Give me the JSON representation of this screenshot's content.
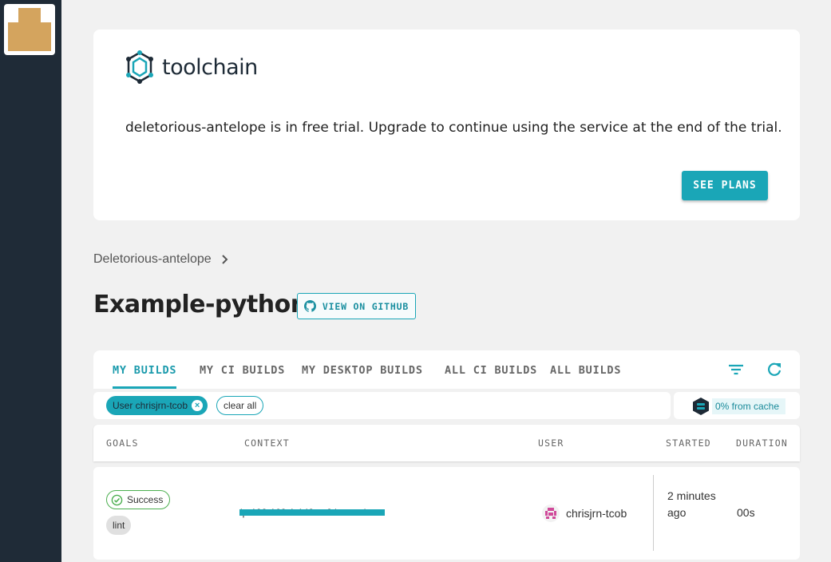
{
  "org": {
    "logo_text": "toolchain",
    "trial_message": "deletorious-antelope is in free trial. Upgrade to continue using the service at the end of the trial.",
    "see_plans_label": "SEE PLANS"
  },
  "breadcrumb": {
    "org_label": "Deletorious-antelope"
  },
  "repo": {
    "title": "Example-python",
    "github_label": "VIEW ON GITHUB"
  },
  "tabs": [
    {
      "label": "MY BUILDS",
      "active": true
    },
    {
      "label": "MY CI BUILDS",
      "active": false
    },
    {
      "label": "MY DESKTOP BUILDS",
      "active": false
    },
    {
      "label": "ALL CI BUILDS",
      "active": false
    },
    {
      "label": "ALL BUILDS",
      "active": false
    }
  ],
  "filters": {
    "user_chip": "User chrisjrn-tcob",
    "clear_label": "clear all"
  },
  "cache": {
    "label": "0% from cache"
  },
  "table": {
    "headers": [
      "GOALS",
      "CONTEXT",
      "USER",
      "STARTED",
      "DURATION"
    ],
    "rows": [
      {
        "status": "Success",
        "goal": "lint",
        "context": "ip-192-168-1-148.ec2.internal",
        "user": "chrisjrn-tcob",
        "started": "2 minutes ago",
        "duration": "00s"
      }
    ]
  },
  "colors": {
    "accent": "#1aa6b7",
    "sidebar": "#1f2b37",
    "success": "#4caf50"
  }
}
